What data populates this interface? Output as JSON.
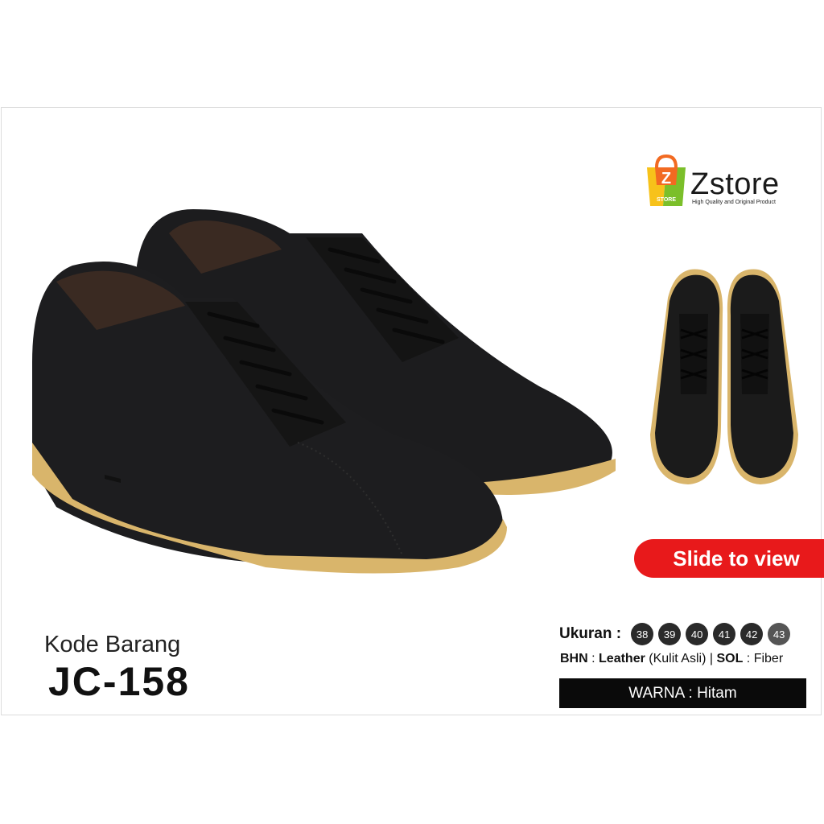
{
  "brand": {
    "logo_letter": "Z",
    "logo_bag_text": "STORE",
    "name": "Zstore",
    "tagline": "High Quality and Original Product"
  },
  "cta": {
    "label": "Slide to view"
  },
  "product": {
    "code_label": "Kode Barang",
    "code_value": "JC-158",
    "size_label": "Ukuran :",
    "sizes": [
      "38",
      "39",
      "40",
      "41",
      "42",
      "43"
    ],
    "material_key": "BHN",
    "material_value": "Leather",
    "material_note": "(Kulit Asli)",
    "separator": "|",
    "sole_key": "SOL",
    "sole_value": "Fiber",
    "color_line": "WARNA : Hitam"
  },
  "colors": {
    "cta_red": "#e8191b",
    "leather": "#1a1a1a",
    "sole": "#d9b56b",
    "logo_orange": "#f26a21",
    "logo_yellow": "#f7c21a",
    "logo_green": "#7bbf2a"
  }
}
